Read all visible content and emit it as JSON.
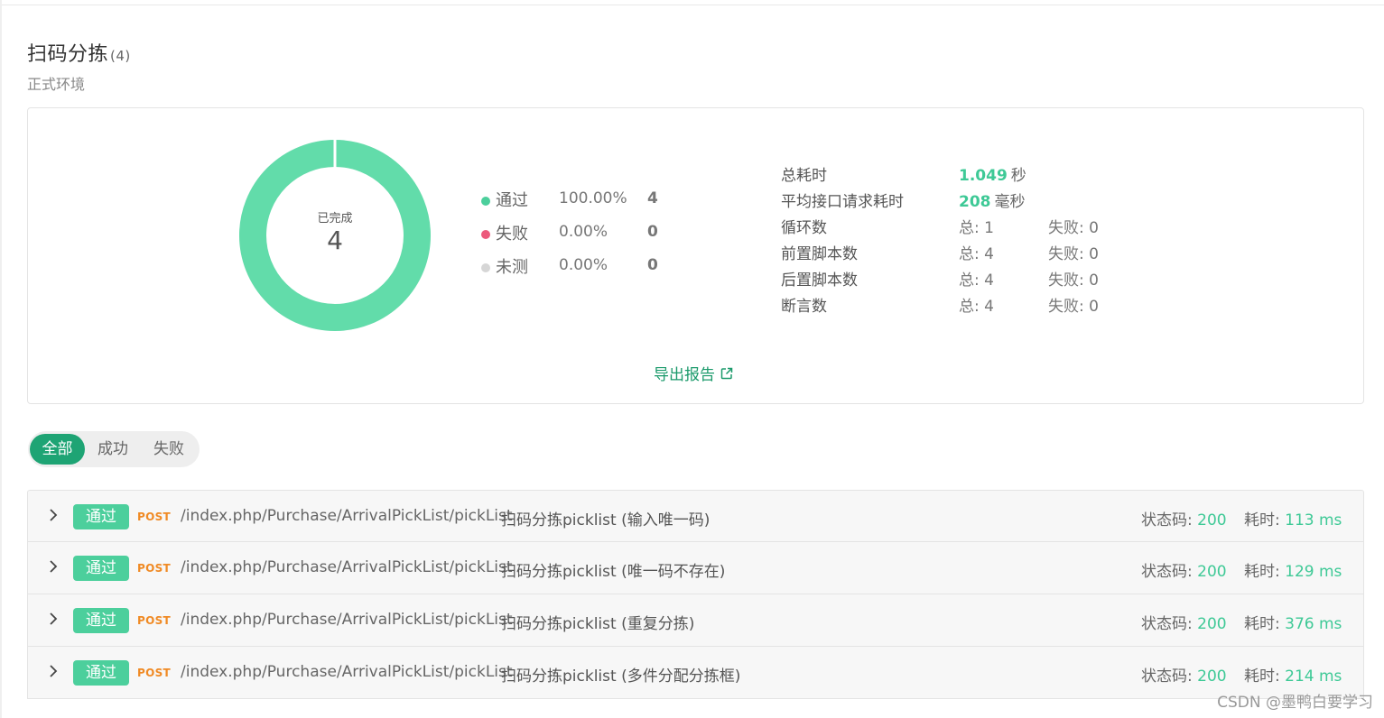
{
  "header": {
    "title": "扫码分拣",
    "count": "(4)",
    "environment": "正式环境"
  },
  "summary": {
    "donut": {
      "label": "已完成",
      "value": "4",
      "pass_fraction": 1.0,
      "color": "#62dcaa"
    },
    "legend": [
      {
        "name": "通过",
        "percent": "100.00%",
        "count": "4",
        "color": "#4ccf9c"
      },
      {
        "name": "失败",
        "percent": "0.00%",
        "count": "0",
        "color": "#ec5a7c"
      },
      {
        "name": "未测",
        "percent": "0.00%",
        "count": "0",
        "color": "#d6d6d6"
      }
    ],
    "stats": {
      "total_time": {
        "label": "总耗时",
        "value": "1.049",
        "unit": "秒"
      },
      "avg_time": {
        "label": "平均接口请求耗时",
        "value": "208",
        "unit": "毫秒"
      },
      "loops": {
        "label": "循环数",
        "total": "总: 1",
        "failed": "失败: 0"
      },
      "pre_scripts": {
        "label": "前置脚本数",
        "total": "总: 4",
        "failed": "失败: 0"
      },
      "post_scripts": {
        "label": "后置脚本数",
        "total": "总: 4",
        "failed": "失败: 0"
      },
      "assertions": {
        "label": "断言数",
        "total": "总: 4",
        "failed": "失败: 0"
      }
    },
    "export_label": "导出报告"
  },
  "filters": [
    {
      "label": "全部",
      "active": true
    },
    {
      "label": "成功",
      "active": false
    },
    {
      "label": "失败",
      "active": false
    }
  ],
  "results": [
    {
      "badge": "通过",
      "method": "POST",
      "path": "/index.php/Purchase/ArrivalPickList/pickList",
      "name": "扫码分拣picklist (输入唯一码)",
      "status_label": "状态码:",
      "status_code": "200",
      "time_label": "耗时:",
      "time_value": "113 ms"
    },
    {
      "badge": "通过",
      "method": "POST",
      "path": "/index.php/Purchase/ArrivalPickList/pickList",
      "name": "扫码分拣picklist (唯一码不存在)",
      "status_label": "状态码:",
      "status_code": "200",
      "time_label": "耗时:",
      "time_value": "129 ms"
    },
    {
      "badge": "通过",
      "method": "POST",
      "path": "/index.php/Purchase/ArrivalPickList/pickList",
      "name": "扫码分拣picklist (重复分拣)",
      "status_label": "状态码:",
      "status_code": "200",
      "time_label": "耗时:",
      "time_value": "376 ms"
    },
    {
      "badge": "通过",
      "method": "POST",
      "path": "/index.php/Purchase/ArrivalPickList/pickList",
      "name": "扫码分拣picklist (多件分配分拣框)",
      "status_label": "状态码:",
      "status_code": "200",
      "time_label": "耗时:",
      "time_value": "214 ms"
    }
  ],
  "watermark": "CSDN @墨鸭白要学习"
}
